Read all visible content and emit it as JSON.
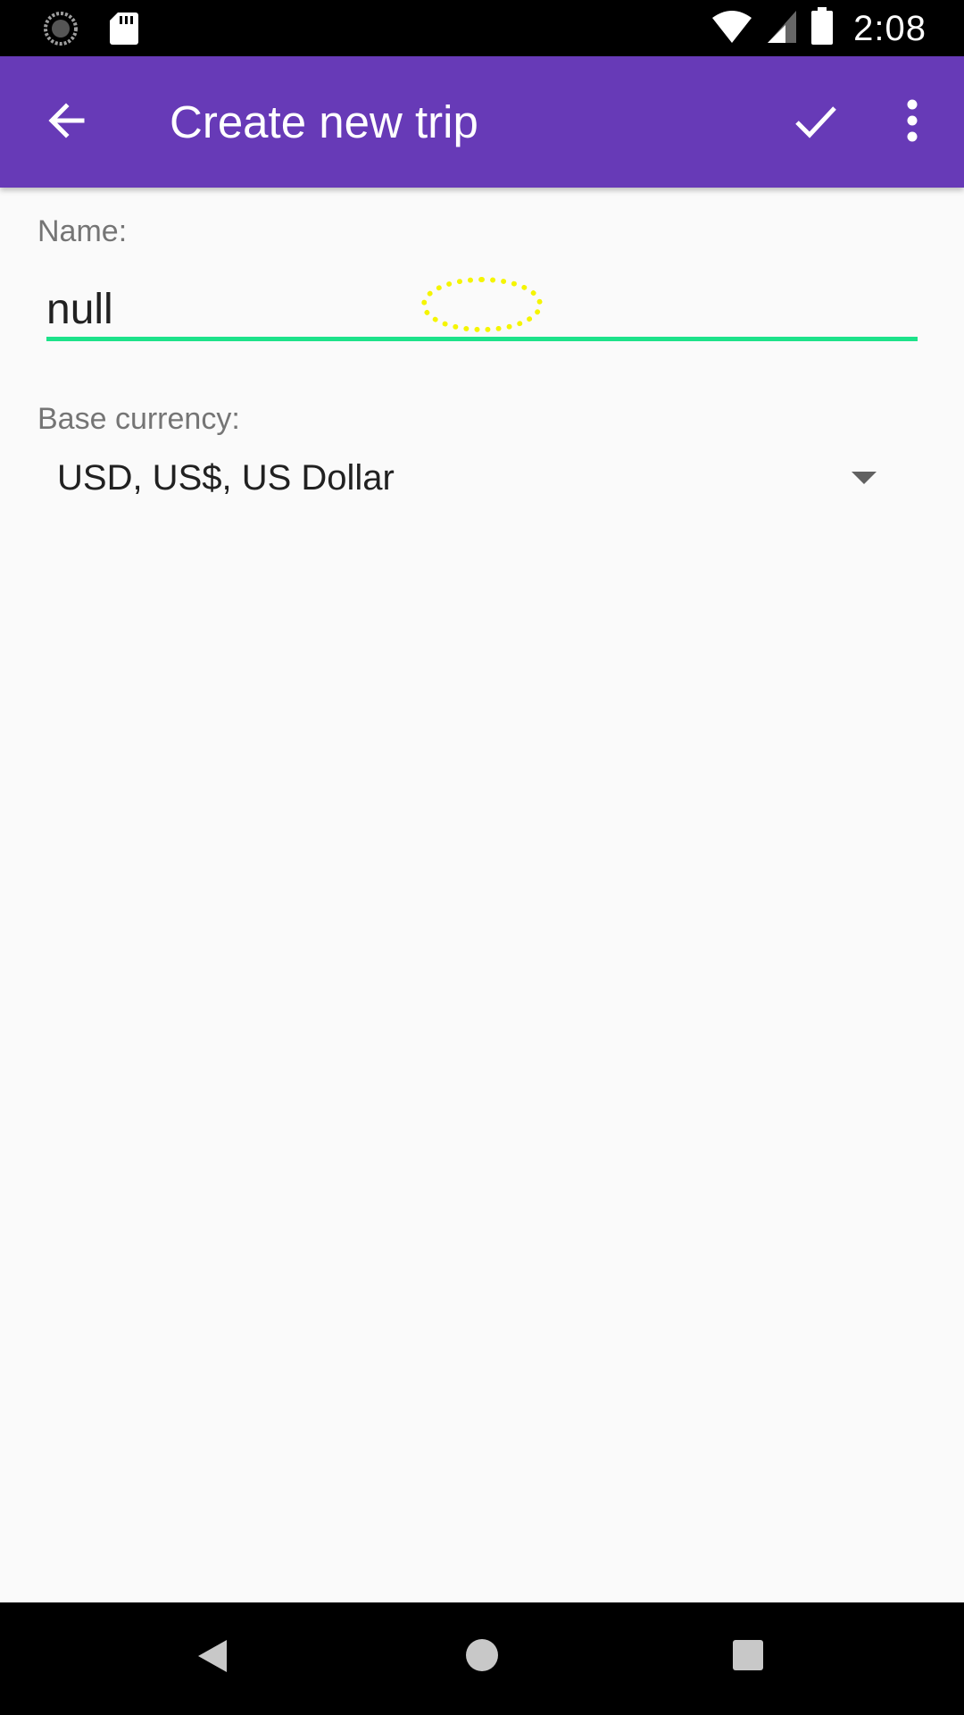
{
  "status_bar": {
    "time": "2:08",
    "icons": [
      "sync-icon",
      "sd-card-icon",
      "wifi-icon",
      "cell-signal-icon",
      "battery-icon"
    ]
  },
  "app_bar": {
    "title": "Create new trip",
    "background": "#673ab7",
    "icons": [
      "back-arrow-icon",
      "check-icon",
      "more-vert-icon"
    ]
  },
  "form": {
    "name_label": "Name:",
    "name_value": "null",
    "accent_color": "#1de28a",
    "currency_label": "Base currency:",
    "currency_value": "USD, US$, US Dollar"
  },
  "nav_bar": {
    "icons": [
      "nav-back-icon",
      "nav-home-icon",
      "nav-recents-icon"
    ]
  }
}
